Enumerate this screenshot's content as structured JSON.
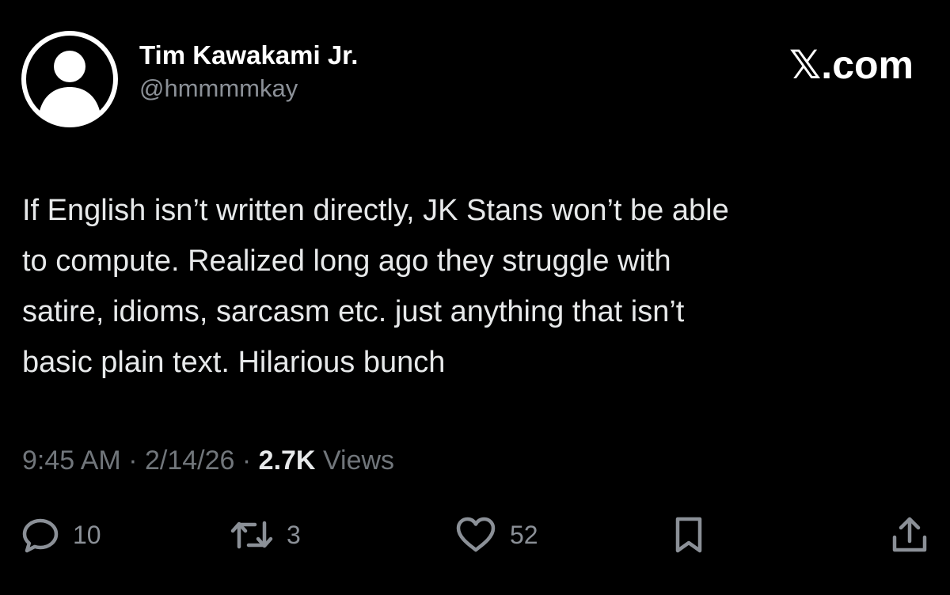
{
  "author": {
    "display_name": "Tim Kawakami Jr.",
    "handle": "@hmmmmkay",
    "avatar_icon": "default-user-avatar-icon"
  },
  "brand": {
    "label": "𝕏.com"
  },
  "tweet": {
    "lines": [
      "If English isn’t written directly, JK Stans won’t be able",
      "to compute. Realized long ago they struggle with",
      "satire, idioms, sarcasm etc. just anything that isn’t",
      "basic plain text. Hilarious bunch"
    ]
  },
  "meta": {
    "time": "9:45 AM",
    "separator": "·",
    "date": "2/14/26",
    "views_count": "2.7K",
    "views_label": "Views"
  },
  "actions": {
    "reply": {
      "icon": "reply-icon",
      "count": "10"
    },
    "repost": {
      "icon": "repost-icon",
      "count": "3"
    },
    "like": {
      "icon": "heart-icon",
      "count": "52"
    },
    "bookmark": {
      "icon": "bookmark-icon"
    },
    "share": {
      "icon": "share-icon"
    }
  },
  "colors": {
    "background": "#000000",
    "primary_text": "#e7e9ea",
    "secondary_text": "#71767b",
    "icon_gray": "#8b9097"
  }
}
